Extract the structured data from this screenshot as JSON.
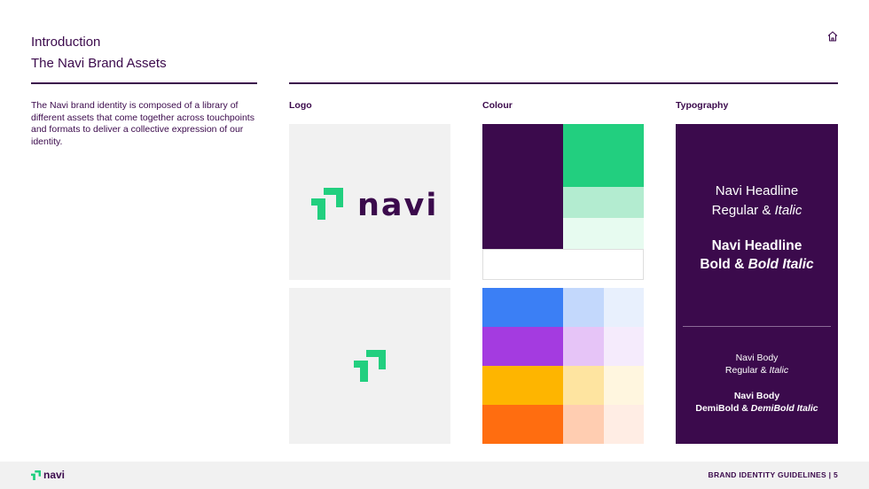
{
  "header": {
    "line1": "Introduction",
    "line2": "The Navi Brand Assets"
  },
  "intro": {
    "body": "The Navi brand identity is composed of a library of different assets that come together across touchpoints and formats to deliver a collective expression of our identity."
  },
  "sections": {
    "logo": "Logo",
    "colour": "Colour",
    "typography": "Typography"
  },
  "logo": {
    "wordmark": "navi"
  },
  "colors": {
    "brand_purple": "#3b0a4c",
    "brand_green": "#22cf7f",
    "green_mid": "#b3ecd0",
    "green_light": "#e7fbf0",
    "blue": [
      "#3b7ff5",
      "#c3d8fc",
      "#e8f0fd"
    ],
    "violet": [
      "#a43be0",
      "#e6c4f7",
      "#f5ebfc"
    ],
    "yellow": [
      "#feb500",
      "#fee4a0",
      "#fff6df"
    ],
    "orange": [
      "#ff6d10",
      "#ffcdb1",
      "#ffede4"
    ]
  },
  "typography": {
    "headline_regular_l1": "Navi Headline",
    "headline_regular_l2a": "Regular & ",
    "headline_regular_l2b": "Italic",
    "headline_bold_l1": "Navi Headline",
    "headline_bold_l2a": "Bold & ",
    "headline_bold_l2b": "Bold Italic",
    "body_regular_l1": "Navi Body",
    "body_regular_l2a": "Regular & ",
    "body_regular_l2b": "Italic",
    "body_demi_l1": "Navi Body",
    "body_demi_l2a": "DemiBold & ",
    "body_demi_l2b": "DemiBold Italic"
  },
  "footer": {
    "logo_text": "navi",
    "label": "BRAND IDENTITY GUIDELINES | 5"
  }
}
